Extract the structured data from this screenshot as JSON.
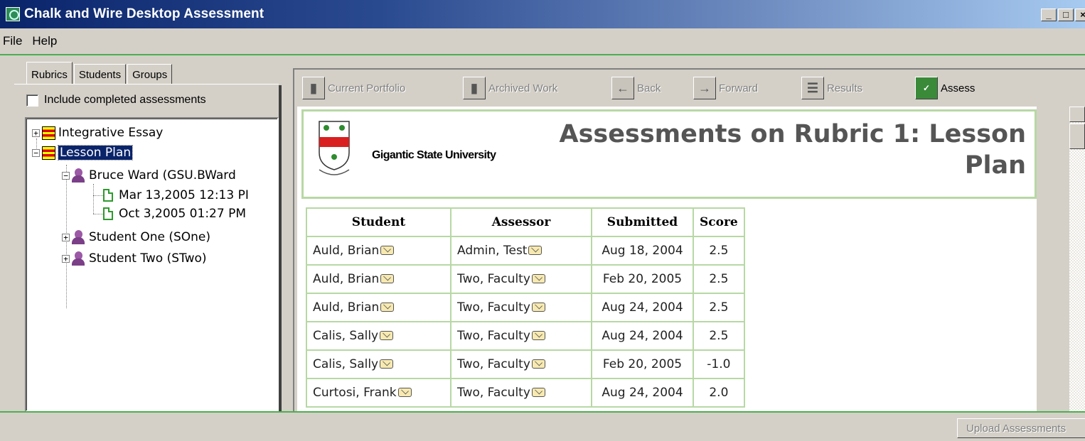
{
  "window": {
    "title": "Chalk and Wire Desktop Assessment",
    "controls": [
      "_",
      "□",
      "×"
    ]
  },
  "menu": {
    "file": "File",
    "help": "Help"
  },
  "left_panel": {
    "tabs": [
      "Rubrics",
      "Students",
      "Groups"
    ],
    "include_completed_label": "Include completed assessments",
    "include_completed_checked": false,
    "tree": {
      "rubric1": "Integrative Essay",
      "rubric2": "Lesson Plan",
      "student1": "Bruce Ward (GSU.BWard",
      "date1": "Mar 13,2005 12:13 PI",
      "date2": "Oct 3,2005 01:27 PM",
      "student2": "Student One (SOne)",
      "student3": "Student Two (STwo)"
    }
  },
  "toolbar": {
    "current_portfolio": "Current Portfolio",
    "archived_work": "Archived Work",
    "back": "Back",
    "forward": "Forward",
    "results": "Results",
    "assess": "Assess"
  },
  "content": {
    "university": "Gigantic State University",
    "title": "Assessments on Rubric 1: Lesson Plan",
    "table": {
      "headers": [
        "Student",
        "Assessor",
        "Submitted",
        "Score"
      ],
      "rows": [
        [
          "Auld, Brian",
          "Admin, Test",
          "Aug 18, 2004",
          "2.5"
        ],
        [
          "Auld, Brian",
          "Two, Faculty",
          "Feb 20, 2005",
          "2.5"
        ],
        [
          "Auld, Brian",
          "Two, Faculty",
          "Aug 24, 2004",
          "2.5"
        ],
        [
          "Calis, Sally",
          "Two, Faculty",
          "Aug 24, 2004",
          "2.5"
        ],
        [
          "Calis, Sally",
          "Two, Faculty",
          "Feb 20, 2005",
          "-1.0"
        ],
        [
          "Curtosi, Frank",
          "Two, Faculty",
          "Aug 24, 2004",
          "2.0"
        ]
      ]
    }
  },
  "status": {
    "upload_button": "Upload Assessments"
  },
  "colors": {
    "accent_green": "#4caf50",
    "table_border": "#b7d8a4",
    "titlebar": "#0a246a",
    "selection": "#0a246a"
  }
}
